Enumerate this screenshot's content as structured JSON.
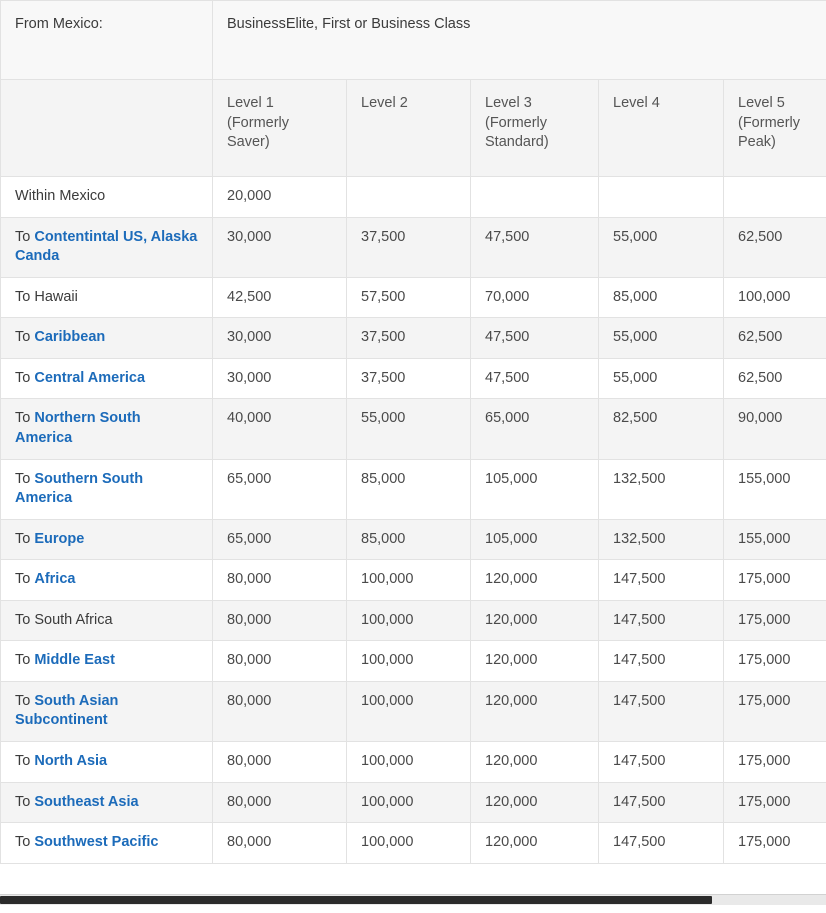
{
  "table": {
    "from_label": "From Mexico:",
    "cabin_label": "BusinessElite, First or Business Class",
    "corner_label": "",
    "columns": [
      "Level 1 (Formerly Saver)",
      "Level 2",
      "Level 3 (Formerly Standard)",
      "Level 4",
      "Level 5 (Formerly Peak)"
    ],
    "column_lines": [
      [
        "Level 1",
        "(Formerly",
        "Saver)"
      ],
      [
        "Level 2"
      ],
      [
        "Level 3",
        "(Formerly",
        "Standard)"
      ],
      [
        "Level 4"
      ],
      [
        "Level 5",
        "(Formerly",
        "Peak)"
      ]
    ],
    "rows": [
      {
        "prefix": "",
        "region": "Within Mexico",
        "is_link": false,
        "values": [
          "20,000",
          "",
          "",
          "",
          ""
        ]
      },
      {
        "prefix": "To ",
        "region": "Contentintal US, Alaska Canda",
        "is_link": true,
        "values": [
          "30,000",
          "37,500",
          "47,500",
          "55,000",
          "62,500"
        ]
      },
      {
        "prefix": "To ",
        "region": "Hawaii",
        "is_link": false,
        "values": [
          "42,500",
          "57,500",
          "70,000",
          "85,000",
          "100,000"
        ]
      },
      {
        "prefix": "To ",
        "region": "Caribbean",
        "is_link": true,
        "values": [
          "30,000",
          "37,500",
          "47,500",
          "55,000",
          "62,500"
        ]
      },
      {
        "prefix": "To ",
        "region": "Central America",
        "is_link": true,
        "values": [
          "30,000",
          "37,500",
          "47,500",
          "55,000",
          "62,500"
        ]
      },
      {
        "prefix": "To ",
        "region": "Northern South America",
        "is_link": true,
        "values": [
          "40,000",
          "55,000",
          "65,000",
          "82,500",
          "90,000"
        ]
      },
      {
        "prefix": "To ",
        "region": "Southern South America",
        "is_link": true,
        "values": [
          "65,000",
          "85,000",
          "105,000",
          "132,500",
          "155,000"
        ]
      },
      {
        "prefix": "To ",
        "region": "Europe",
        "is_link": true,
        "values": [
          "65,000",
          "85,000",
          "105,000",
          "132,500",
          "155,000"
        ]
      },
      {
        "prefix": "To ",
        "region": "Africa",
        "is_link": true,
        "values": [
          "80,000",
          "100,000",
          "120,000",
          "147,500",
          "175,000"
        ]
      },
      {
        "prefix": "To ",
        "region": "South Africa",
        "is_link": false,
        "values": [
          "80,000",
          "100,000",
          "120,000",
          "147,500",
          "175,000"
        ]
      },
      {
        "prefix": "To ",
        "region": "Middle East",
        "is_link": true,
        "values": [
          "80,000",
          "100,000",
          "120,000",
          "147,500",
          "175,000"
        ]
      },
      {
        "prefix": "To ",
        "region": "South Asian Subcontinent",
        "is_link": true,
        "values": [
          "80,000",
          "100,000",
          "120,000",
          "147,500",
          "175,000"
        ]
      },
      {
        "prefix": "To ",
        "region": "North Asia",
        "is_link": true,
        "values": [
          "80,000",
          "100,000",
          "120,000",
          "147,500",
          "175,000"
        ]
      },
      {
        "prefix": "To ",
        "region": "Southeast Asia",
        "is_link": true,
        "values": [
          "80,000",
          "100,000",
          "120,000",
          "147,500",
          "175,000"
        ]
      },
      {
        "prefix": "To ",
        "region": "Southwest Pacific",
        "is_link": true,
        "values": [
          "80,000",
          "100,000",
          "120,000",
          "147,500",
          "175,000"
        ]
      }
    ]
  },
  "colors": {
    "link": "#1c6bba",
    "text": "#3b3b3b",
    "row_alt": "#f4f4f4",
    "header": "#f4f4f4",
    "border": "#e2e2e2"
  }
}
